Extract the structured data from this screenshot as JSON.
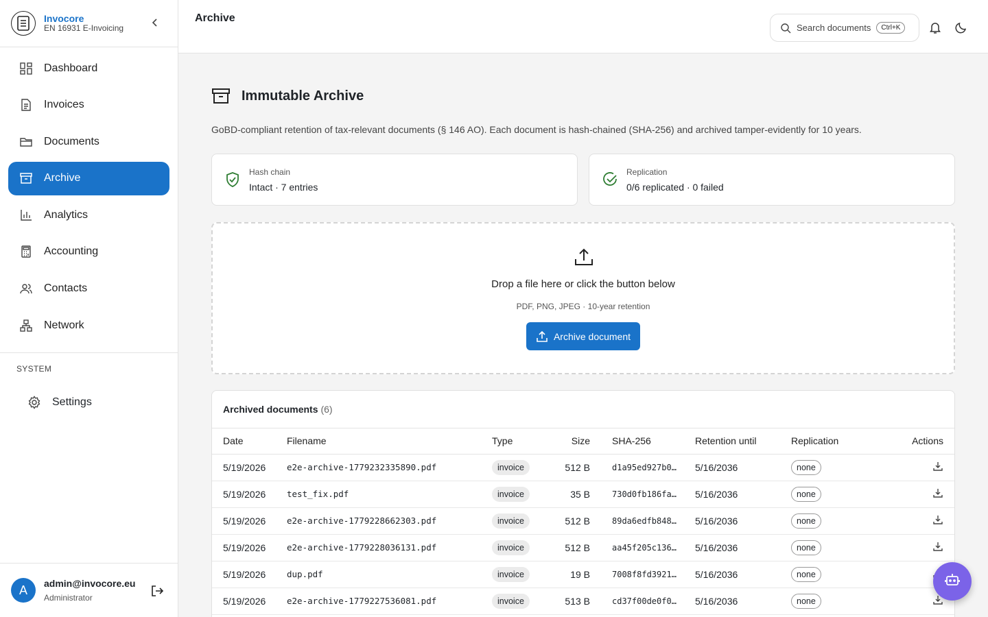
{
  "brand": {
    "name": "Invocore",
    "subtitle": "EN 16931 E-Invoicing"
  },
  "nav": [
    {
      "label": "Dashboard",
      "icon": "dashboard-icon"
    },
    {
      "label": "Invoices",
      "icon": "invoice-icon"
    },
    {
      "label": "Documents",
      "icon": "folder-icon"
    },
    {
      "label": "Archive",
      "icon": "archive-icon",
      "active": true
    },
    {
      "label": "Analytics",
      "icon": "chart-icon"
    },
    {
      "label": "Accounting",
      "icon": "calculator-icon"
    },
    {
      "label": "Contacts",
      "icon": "contacts-icon"
    },
    {
      "label": "Network",
      "icon": "network-icon"
    }
  ],
  "system": {
    "section_label": "SYSTEM",
    "settings_label": "Settings"
  },
  "user": {
    "initial": "A",
    "email": "admin@invocore.eu",
    "role": "Administrator"
  },
  "header": {
    "title": "Archive",
    "search_placeholder": "Search documents",
    "shortcut": "Ctrl+K"
  },
  "page": {
    "title": "Immutable Archive",
    "description": "GoBD-compliant retention of tax-relevant documents (§ 146 AO). Each document is hash-chained (SHA-256) and archived tamper-evidently for 10 years."
  },
  "stats": {
    "hash": {
      "label": "Hash chain",
      "value": "Intact · 7 entries"
    },
    "replication": {
      "label": "Replication",
      "value": "0/6 replicated · 0 failed"
    }
  },
  "dropzone": {
    "text": "Drop a file here or click the button below",
    "hint": "PDF, PNG, JPEG · 10-year retention",
    "button": "Archive document"
  },
  "table": {
    "title": "Archived documents",
    "count": "(6)",
    "columns": [
      "Date",
      "Filename",
      "Type",
      "Size",
      "SHA-256",
      "Retention until",
      "Replication",
      "Actions"
    ],
    "rows": [
      {
        "date": "5/19/2026",
        "file": "e2e-archive-1779232335890.pdf",
        "type": "invoice",
        "size": "512 B",
        "sha": "d1a95ed927b0…",
        "ret": "5/16/2036",
        "rep": "none"
      },
      {
        "date": "5/19/2026",
        "file": "test_fix.pdf",
        "type": "invoice",
        "size": "35 B",
        "sha": "730d0fb186fa…",
        "ret": "5/16/2036",
        "rep": "none"
      },
      {
        "date": "5/19/2026",
        "file": "e2e-archive-1779228662303.pdf",
        "type": "invoice",
        "size": "512 B",
        "sha": "89da6edfb848…",
        "ret": "5/16/2036",
        "rep": "none"
      },
      {
        "date": "5/19/2026",
        "file": "e2e-archive-1779228036131.pdf",
        "type": "invoice",
        "size": "512 B",
        "sha": "aa45f205c136…",
        "ret": "5/16/2036",
        "rep": "none"
      },
      {
        "date": "5/19/2026",
        "file": "dup.pdf",
        "type": "invoice",
        "size": "19 B",
        "sha": "7008f8fd3921…",
        "ret": "5/16/2036",
        "rep": "none"
      },
      {
        "date": "5/19/2026",
        "file": "e2e-archive-1779227536081.pdf",
        "type": "invoice",
        "size": "513 B",
        "sha": "cd37f00de0f0…",
        "ret": "5/16/2036",
        "rep": "none"
      }
    ]
  },
  "colors": {
    "accent": "#1a73c9",
    "success": "#2e7d32",
    "fab": "#7b63e8"
  }
}
